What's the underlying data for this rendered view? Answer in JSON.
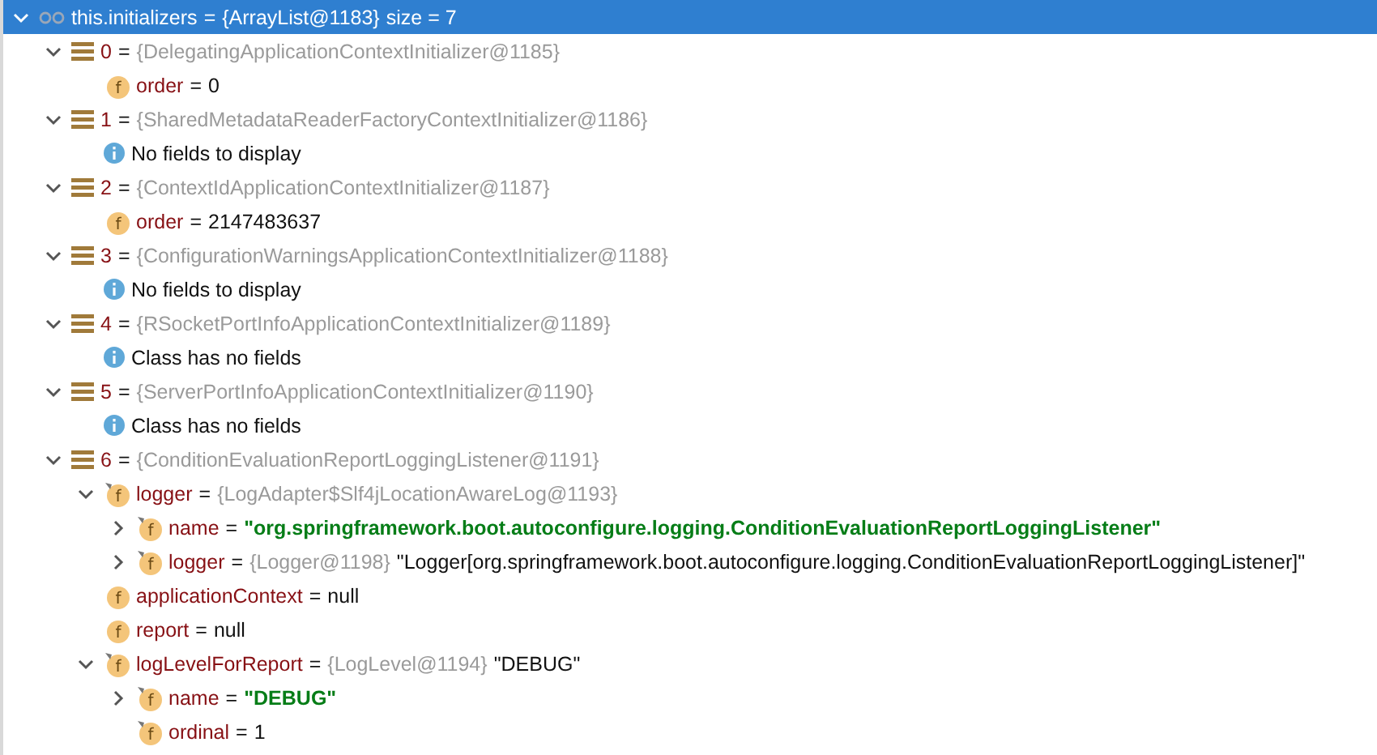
{
  "tree": [
    {
      "kind": "watch",
      "name": "this.initializers",
      "selected": true,
      "expanded": true,
      "parts": [
        {
          "kind": "plain",
          "text": "="
        },
        {
          "kind": "plain",
          "text": "{ArrayList@1183}"
        },
        {
          "kind": "plain",
          "text": " size = 7"
        }
      ],
      "children": [
        {
          "kind": "element",
          "name": "0",
          "selected": false,
          "expanded": true,
          "parts": [
            {
              "kind": "plain",
              "text": "="
            },
            {
              "kind": "type",
              "text": "{DelegatingApplicationContextInitializer@1185}"
            }
          ],
          "children": [
            {
              "kind": "field",
              "icon": "f",
              "name": "order",
              "selected": false,
              "final": false,
              "parts": [
                {
                  "kind": "plain",
                  "text": "="
                },
                {
                  "kind": "plain",
                  "text": "0"
                }
              ]
            }
          ]
        },
        {
          "kind": "element",
          "name": "1",
          "selected": false,
          "expanded": true,
          "parts": [
            {
              "kind": "plain",
              "text": "="
            },
            {
              "kind": "type",
              "text": "{SharedMetadataReaderFactoryContextInitializer@1186}"
            }
          ],
          "children": [
            {
              "kind": "info",
              "text": "No fields to display",
              "selected": false
            }
          ]
        },
        {
          "kind": "element",
          "name": "2",
          "selected": false,
          "expanded": true,
          "parts": [
            {
              "kind": "plain",
              "text": "="
            },
            {
              "kind": "type",
              "text": "{ContextIdApplicationContextInitializer@1187}"
            }
          ],
          "children": [
            {
              "kind": "field",
              "icon": "f",
              "name": "order",
              "selected": false,
              "final": false,
              "parts": [
                {
                  "kind": "plain",
                  "text": "="
                },
                {
                  "kind": "plain",
                  "text": "2147483637"
                }
              ]
            }
          ]
        },
        {
          "kind": "element",
          "name": "3",
          "selected": false,
          "expanded": true,
          "parts": [
            {
              "kind": "plain",
              "text": "="
            },
            {
              "kind": "type",
              "text": "{ConfigurationWarningsApplicationContextInitializer@1188}"
            }
          ],
          "children": [
            {
              "kind": "info",
              "text": "No fields to display",
              "selected": false
            }
          ]
        },
        {
          "kind": "element",
          "name": "4",
          "selected": false,
          "expanded": true,
          "parts": [
            {
              "kind": "plain",
              "text": "="
            },
            {
              "kind": "type",
              "text": "{RSocketPortInfoApplicationContextInitializer@1189}"
            }
          ],
          "children": [
            {
              "kind": "info",
              "text": "Class has no fields",
              "selected": false
            }
          ]
        },
        {
          "kind": "element",
          "name": "5",
          "selected": false,
          "expanded": true,
          "parts": [
            {
              "kind": "plain",
              "text": "="
            },
            {
              "kind": "type",
              "text": "{ServerPortInfoApplicationContextInitializer@1190}"
            }
          ],
          "children": [
            {
              "kind": "info",
              "text": "Class has no fields",
              "selected": false
            }
          ]
        },
        {
          "kind": "element",
          "name": "6",
          "selected": false,
          "expanded": true,
          "parts": [
            {
              "kind": "plain",
              "text": "="
            },
            {
              "kind": "type",
              "text": "{ConditionEvaluationReportLoggingListener@1191}"
            }
          ],
          "children": [
            {
              "kind": "field",
              "icon": "f",
              "name": "logger",
              "selected": false,
              "final": true,
              "expanded": true,
              "parts": [
                {
                  "kind": "plain",
                  "text": "="
                },
                {
                  "kind": "type",
                  "text": "{LogAdapter$Slf4jLocationAwareLog@1193}"
                }
              ],
              "children": [
                {
                  "kind": "field",
                  "icon": "f",
                  "name": "name",
                  "selected": false,
                  "final": true,
                  "expanded": false,
                  "parts": [
                    {
                      "kind": "plain",
                      "text": "="
                    },
                    {
                      "kind": "string",
                      "text": "\"org.springframework.boot.autoconfigure.logging.ConditionEvaluationReportLoggingListener\""
                    }
                  ]
                },
                {
                  "kind": "field",
                  "icon": "f",
                  "name": "logger",
                  "selected": false,
                  "final": true,
                  "expanded": false,
                  "parts": [
                    {
                      "kind": "plain",
                      "text": "="
                    },
                    {
                      "kind": "type",
                      "text": "{Logger@1198}"
                    },
                    {
                      "kind": "plain",
                      "text": "\"Logger[org.springframework.boot.autoconfigure.logging.ConditionEvaluationReportLoggingListener]\""
                    }
                  ]
                }
              ]
            },
            {
              "kind": "field",
              "icon": "f",
              "name": "applicationContext",
              "selected": false,
              "final": false,
              "parts": [
                {
                  "kind": "plain",
                  "text": "="
                },
                {
                  "kind": "plain",
                  "text": "null"
                }
              ]
            },
            {
              "kind": "field",
              "icon": "f",
              "name": "report",
              "selected": false,
              "final": false,
              "parts": [
                {
                  "kind": "plain",
                  "text": "="
                },
                {
                  "kind": "plain",
                  "text": "null"
                }
              ]
            },
            {
              "kind": "field",
              "icon": "f",
              "name": "logLevelForReport",
              "selected": false,
              "final": true,
              "expanded": true,
              "parts": [
                {
                  "kind": "plain",
                  "text": "="
                },
                {
                  "kind": "type",
                  "text": "{LogLevel@1194}"
                },
                {
                  "kind": "plain",
                  "text": "\"DEBUG\""
                }
              ],
              "children": [
                {
                  "kind": "field",
                  "icon": "f",
                  "name": "name",
                  "selected": false,
                  "final": true,
                  "expanded": false,
                  "parts": [
                    {
                      "kind": "plain",
                      "text": "="
                    },
                    {
                      "kind": "string",
                      "text": "\"DEBUG\""
                    }
                  ]
                },
                {
                  "kind": "field",
                  "icon": "f",
                  "name": "ordinal",
                  "selected": false,
                  "final": true,
                  "parts": [
                    {
                      "kind": "plain",
                      "text": "="
                    },
                    {
                      "kind": "plain",
                      "text": "1"
                    }
                  ]
                }
              ]
            }
          ]
        }
      ]
    }
  ]
}
